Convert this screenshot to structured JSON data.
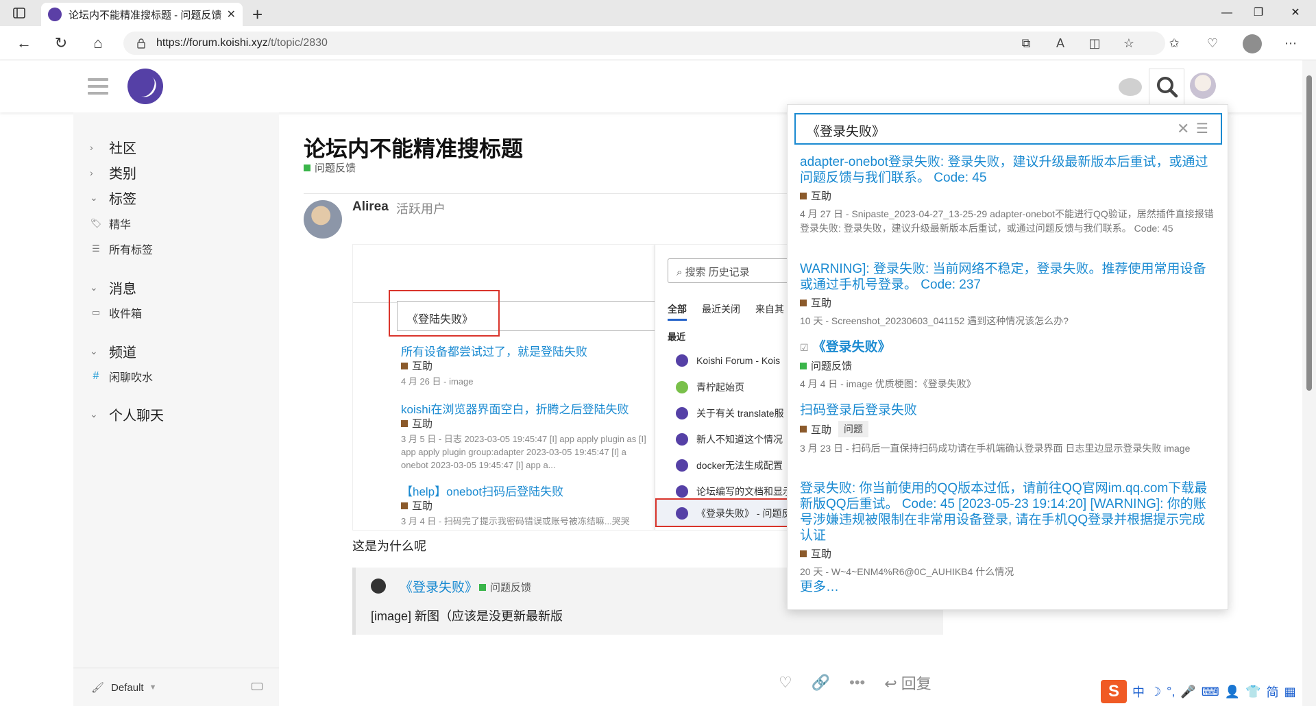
{
  "browser": {
    "tab_title": "论坛内不能精准搜标题 - 问题反馈",
    "url_host": "https://forum.koishi.xyz",
    "url_path": "/t/topic/2830"
  },
  "sidebar": {
    "community": "社区",
    "categories": "类别",
    "tags": "标签",
    "tag_featured": "精华",
    "tag_all": "所有标签",
    "messages": "消息",
    "inbox": "收件箱",
    "channels": "频道",
    "channel_chat": "闲聊吹水",
    "personal_chat": "个人聊天",
    "theme": "Default"
  },
  "topic": {
    "title": "论坛内不能精准搜标题",
    "category": "问题反馈",
    "category_color": "#3ab54a"
  },
  "post": {
    "username": "Alirea",
    "user_title": "活跃用户",
    "text": "这是为什么呢",
    "quote_title": "《登录失败》",
    "quote_category": "问题反馈",
    "quote_body": "[image] 新图（应该是没更新最新版"
  },
  "embed": {
    "search_value": "《登陆失败》",
    "results": [
      {
        "title": "所有设备都尝试过了，就是登陆失败",
        "tag": "互助",
        "meta": "4 月 26 日 - image"
      },
      {
        "title": "koishi在浏览器界面空白，折腾之后登陆失败",
        "tag": "互助",
        "meta": "3 月 5 日 - 日志 2023-03-05 19:45:47 [I] app apply plugin as [I] app apply plugin group:adapter 2023-03-05 19:45:47 [I] a onebot 2023-03-05 19:45:47 [I] app a..."
      },
      {
        "title": "【help】onebot扫码后登陆失败",
        "tag": "互助",
        "meta": "3 月 4 日 - 扫码完了提示我密码错误或账号被冻结嘛...哭哭"
      }
    ],
    "history_placeholder": "搜索 历史记录",
    "tabs": [
      "全部",
      "最近关闭",
      "来自其"
    ],
    "recent_label": "最近",
    "history_items": [
      "Koishi Forum - Kois",
      "青柠起始页",
      "关于有关 translate服",
      "新人不知道这个情况",
      "docker无法生成配置",
      "论坛编写的文档和显示",
      "《登录失败》 - 问题反"
    ]
  },
  "search_menu": {
    "query": "《登录失败》",
    "results": [
      {
        "title": "adapter-onebot登录失败: 登录失败，建议升级最新版本后重试，或通过问题反馈与我们联系。 Code: 45",
        "tag": "互助",
        "meta": "4 月 27 日 - Snipaste_2023-04-27_13-25-29 adapter-onebot不能进行QQ验证，居然插件直接报错登录失败: 登录失败，建议升级最新版本后重试，或通过问题反馈与我们联系。 Code: 45"
      },
      {
        "title": "WARNING]: 登录失败: 当前网络不稳定，登录失败。推荐使用常用设备或通过手机号登录。 Code: 237",
        "tag": "互助",
        "meta": "10 天 - Screenshot_20230603_041152 遇到这种情况该怎么办?"
      },
      {
        "title": "《登录失败》",
        "tag": "问题反馈",
        "meta": "4 月 4 日 - image 优质梗图：《登录失败》"
      },
      {
        "title": "扫码登录后登录失败",
        "tag": "互助",
        "tag2": "问题",
        "meta": "3 月 23 日 - 扫码后一直保持扫码成功请在手机端确认登录界面 日志里边显示登录失败 image"
      },
      {
        "title": "登录失败: 你当前使用的QQ版本过低，请前往QQ官网im.qq.com下载最新版QQ后重试。 Code: 45 [2023-05-23 19:14:20] [WARNING]: 你的账号涉嫌违规被限制在非常用设备登录, 请在手机QQ登录并根据提示完成认证",
        "tag": "互助",
        "meta": "20 天 - W~4~ENM4%R6@0C_AUHIKB4 什么情况"
      }
    ],
    "more": "更多…",
    "tag_color_help": "#8b5a2b",
    "tag_color_feedback": "#3ab54a"
  },
  "post_actions": {
    "reply": "回复"
  },
  "ime": {
    "mode": "中",
    "simplified": "简"
  }
}
